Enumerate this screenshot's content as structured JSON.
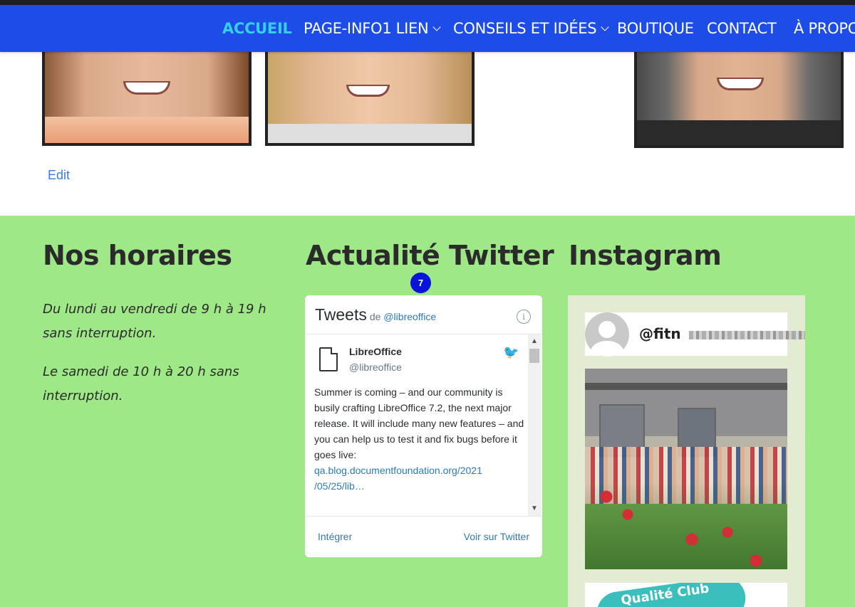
{
  "nav": {
    "items": [
      {
        "label": "ACCUEIL",
        "active": true,
        "dropdown": false
      },
      {
        "label": "PAGE-INFO1 LIEN",
        "active": false,
        "dropdown": true
      },
      {
        "label": "CONSEILS ET IDÉES",
        "active": false,
        "dropdown": true
      },
      {
        "label": "BOUTIQUE",
        "active": false,
        "dropdown": false
      },
      {
        "label": "CONTACT",
        "active": false,
        "dropdown": false
      },
      {
        "label": "À PROPO",
        "active": false,
        "dropdown": false
      }
    ],
    "accent_color": "#1d4de6",
    "active_color": "#35d0e8"
  },
  "content": {
    "edit_link": "Edit"
  },
  "footer": {
    "background": "#9ee887",
    "hours": {
      "title": "Nos horaires",
      "lines": [
        "Du lundi au vendredi de 9 h à 19 h sans interruption.",
        "Le samedi de 10 h à 20 h sans interruption."
      ]
    },
    "twitter": {
      "title": "Actualité Twitter",
      "badge": "7",
      "widget": {
        "title": "Tweets",
        "by_prefix": "de",
        "by_handle": "@libreoffice",
        "tweet": {
          "name": "LibreOffice",
          "handle": "@libreoffice",
          "text": "Summer is coming – and our community is busily crafting LibreOffice 7.2, the next major release. It will include many new features – and you can help us to test it and fix bugs before it goes live:",
          "link_line1": "qa.blog.documentfoundation.org/2021",
          "link_line2": "/05/25/lib…"
        },
        "embed_label": "Intégrer",
        "view_label": "Voir sur Twitter"
      }
    },
    "instagram": {
      "title": "Instagram",
      "handle": "@fitn",
      "logo_text": "Qualité Club"
    }
  }
}
